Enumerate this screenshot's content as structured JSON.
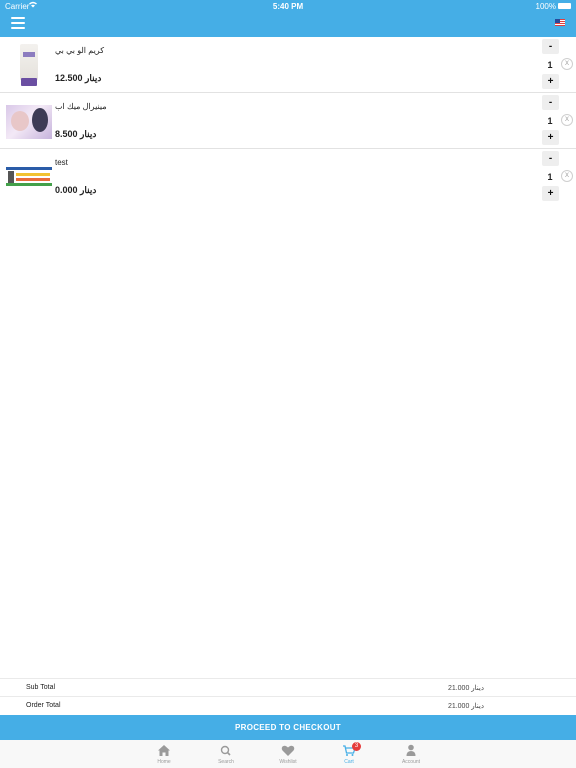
{
  "status_bar": {
    "carrier": "Carrier",
    "time": "5:40 PM",
    "battery": "100%"
  },
  "cart": {
    "items": [
      {
        "name": "كريم الو بي بي",
        "price": "12.500 دينار",
        "quantity": "1",
        "minus": "-",
        "plus": "+",
        "remove": "X"
      },
      {
        "name": "مينيرال ميك اب",
        "price": "8.500 دينار",
        "quantity": "1",
        "minus": "-",
        "plus": "+",
        "remove": "X"
      },
      {
        "name": "test",
        "price": "0.000 دينار",
        "quantity": "1",
        "minus": "-",
        "plus": "+",
        "remove": "X"
      }
    ]
  },
  "totals": {
    "sub_total_label": "Sub Total",
    "sub_total_value": "21.000 دينار",
    "order_total_label": "Order Total",
    "order_total_value": "21.000 دينار"
  },
  "checkout_label": "PROCEED TO CHECKOUT",
  "tabs": [
    {
      "label": "Home",
      "icon": "home-icon"
    },
    {
      "label": "Search",
      "icon": "search-icon"
    },
    {
      "label": "Wishlist",
      "icon": "heart-icon"
    },
    {
      "label": "Cart",
      "icon": "cart-icon",
      "badge": "3"
    },
    {
      "label": "Account",
      "icon": "user-icon"
    }
  ],
  "colors": {
    "accent": "#45aee6",
    "badge": "#e53b3b"
  }
}
